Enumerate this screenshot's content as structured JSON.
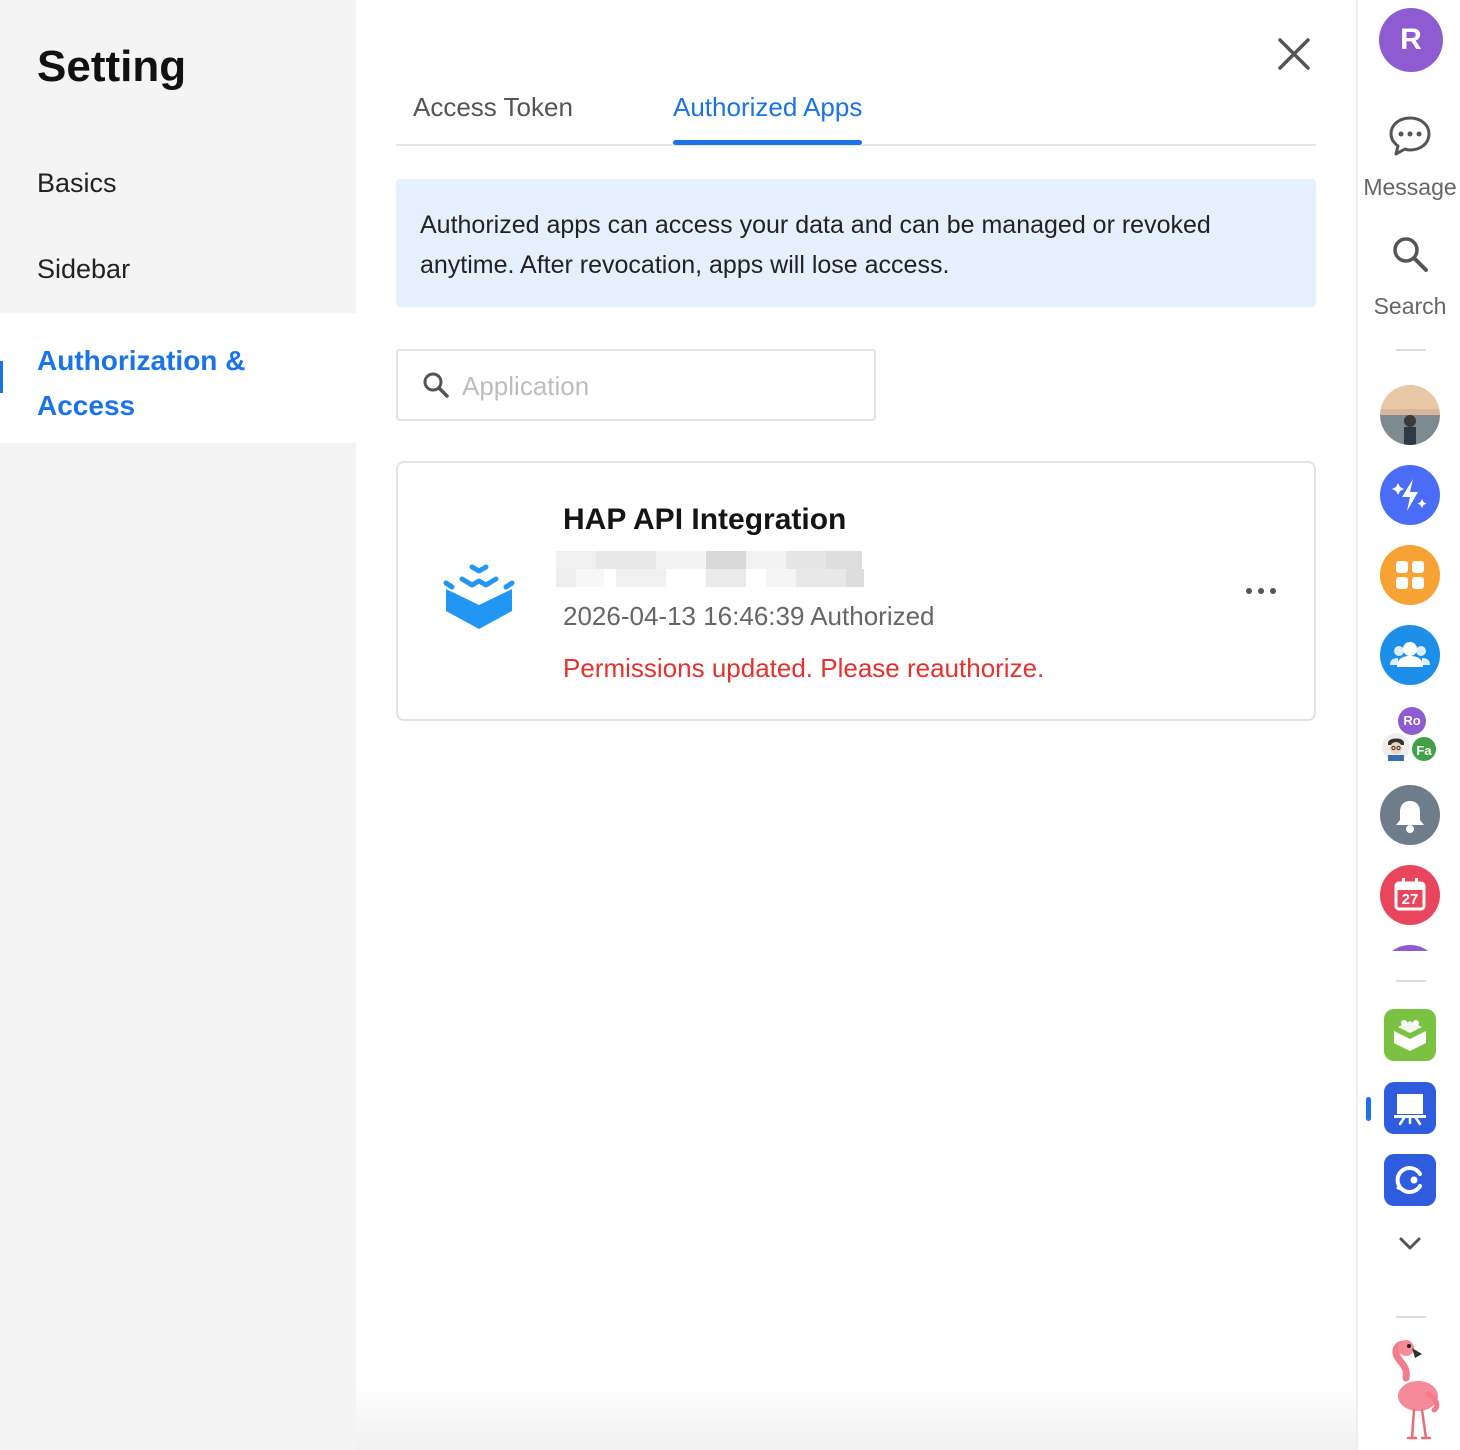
{
  "sidebar": {
    "title": "Setting",
    "items": [
      {
        "label": "Basics"
      },
      {
        "label": "Sidebar"
      },
      {
        "label_line1": "Authorization &",
        "label_line2": "Access",
        "active": true
      }
    ]
  },
  "tabs": [
    {
      "label": "Access Token"
    },
    {
      "label": "Authorized Apps",
      "active": true
    }
  ],
  "notice": {
    "text": "Authorized apps can access your data and can be managed or revoked anytime. After revocation, apps will lose access."
  },
  "search": {
    "placeholder": "Application"
  },
  "app_card": {
    "name": "HAP API Integration",
    "authorized_at": "2026-04-13 16:46:39 Authorized",
    "warning": "Permissions updated. Please reauthorize."
  },
  "rail": {
    "avatar_initial": "R",
    "message_label": "Message",
    "search_label": "Search",
    "group_badge_1": "Ro",
    "group_badge_2": "Fa",
    "calendar_day": "27"
  },
  "colors": {
    "accent": "#1a73e8",
    "warning": "#e5322d",
    "notice_bg": "#e6effd"
  }
}
